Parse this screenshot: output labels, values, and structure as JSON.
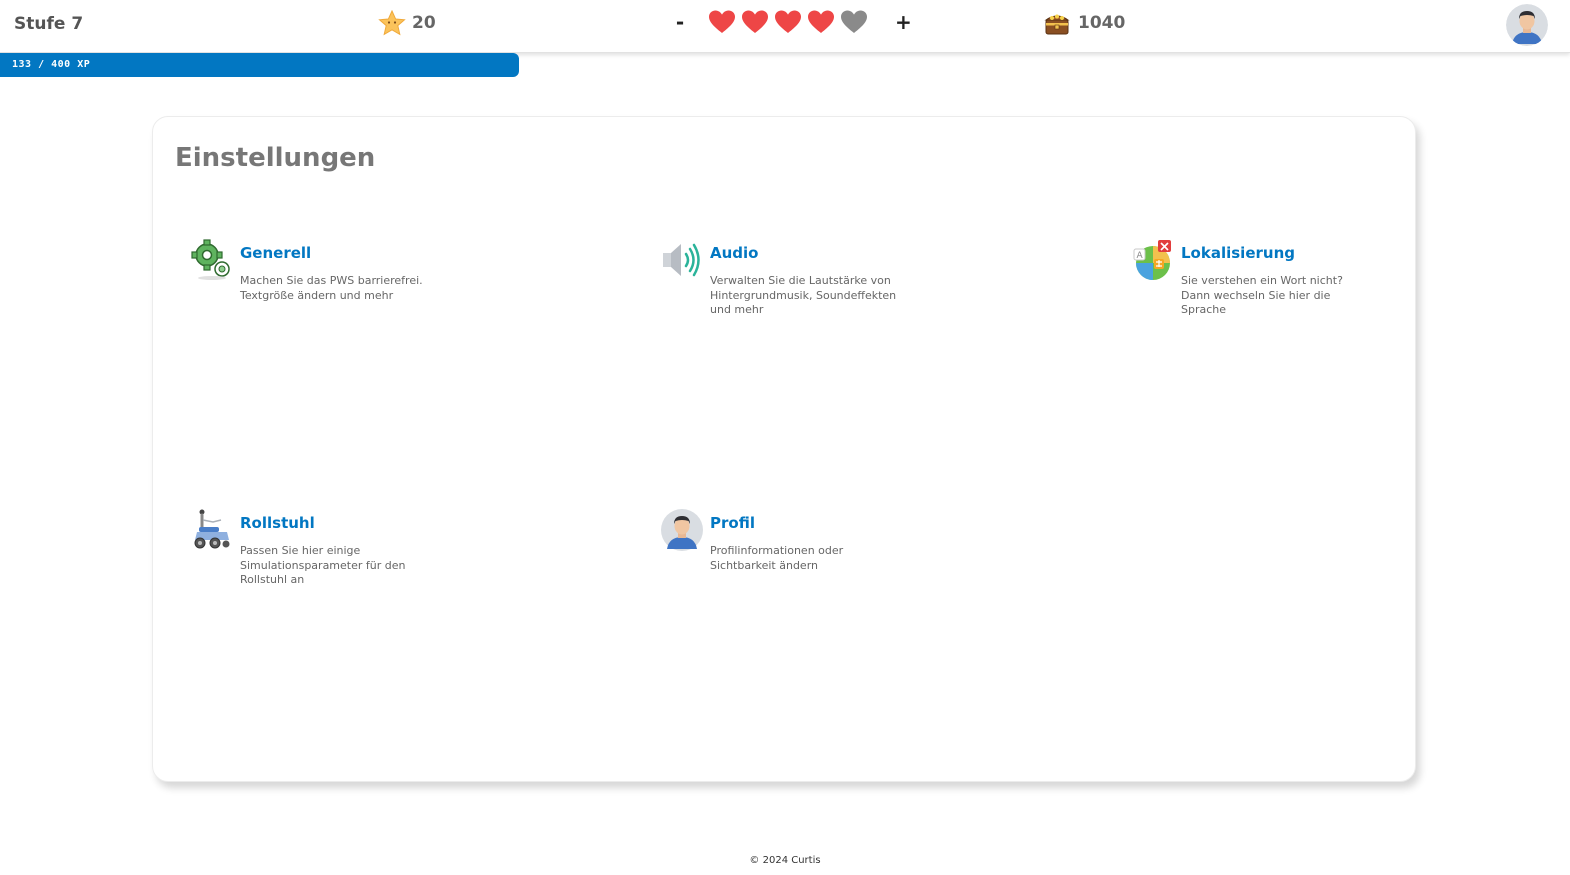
{
  "header": {
    "level_label": "Stufe 7",
    "stars": "20",
    "lives_minus": "-",
    "lives_plus": "+",
    "lives": {
      "filled": 4,
      "total": 5
    },
    "coins": "1040",
    "colors": {
      "heart": "#ee4646",
      "heart_empty": "#8a8a8a",
      "accent": "#0277c2"
    }
  },
  "xp": {
    "text": "133 / 400 XP",
    "current": 133,
    "max": 400
  },
  "settings": {
    "title": "Einstellungen",
    "items": [
      {
        "icon": "gears-icon",
        "label": "Generell",
        "description": "Machen Sie das PWS barrierefrei. Textgröße ändern und mehr"
      },
      {
        "icon": "speaker-icon",
        "label": "Audio",
        "description": "Verwalten Sie die Lautstärke von Hintergrundmusik, Soundeffekten und mehr"
      },
      {
        "icon": "language-icon",
        "label": "Lokalisierung",
        "description": "Sie verstehen ein Wort nicht? Dann wechseln Sie hier die Sprache"
      },
      {
        "icon": "wheelchair-icon",
        "label": "Rollstuhl",
        "description": "Passen Sie hier einige Simulationsparameter für den Rollstuhl an"
      },
      {
        "icon": "profile-icon",
        "label": "Profil",
        "description": "Profilinformationen oder Sichtbarkeit ändern"
      }
    ]
  },
  "footer": {
    "copyright": "© 2024 Curtis"
  }
}
